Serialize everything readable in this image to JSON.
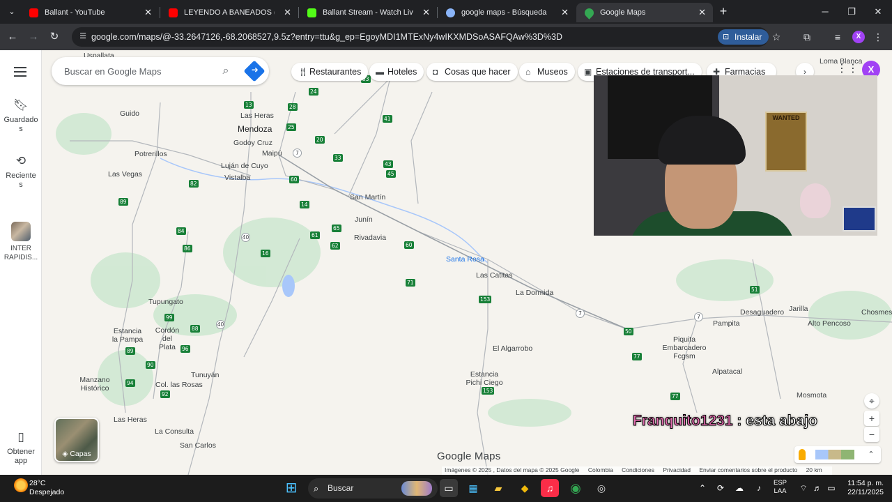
{
  "browser": {
    "tabs": [
      {
        "title": "Ballant - YouTube",
        "favicon_color": "#ff0000",
        "active": false
      },
      {
        "title": "LEYENDO A BANEADOS (de nu",
        "favicon_color": "#ff0000",
        "active": false
      },
      {
        "title": "Ballant Stream - Watch Live on",
        "favicon_color": "#53fc18",
        "active": false
      },
      {
        "title": "google maps - Búsqueda",
        "favicon_color": "#8ab4f8",
        "active": false
      },
      {
        "title": "Google Maps",
        "favicon_color": "#34a853",
        "active": true
      }
    ],
    "url": "google.com/maps/@-33.2647126,-68.2068527,9.5z?entry=ttu&g_ep=EgoyMDI1MTExNy4wIKXMDSoASAFQAw%3D%3D",
    "install_label": "Instalar",
    "profile_letter": "X"
  },
  "rail": {
    "saved": "Guardados",
    "recent": "Recientes",
    "pinned_app": "INTER RAPIDIS...",
    "get_app": "Obtener app"
  },
  "search": {
    "placeholder": "Buscar en Google Maps"
  },
  "chips": [
    {
      "label": "Restaurantes",
      "icon": "fork-knife-icon"
    },
    {
      "label": "Hoteles",
      "icon": "bed-icon"
    },
    {
      "label": "Cosas que hacer",
      "icon": "camera-icon"
    },
    {
      "label": "Museos",
      "icon": "museum-icon"
    },
    {
      "label": "Estaciones de transport...",
      "icon": "train-icon"
    },
    {
      "label": "Farmacias",
      "icon": "pharmacy-icon"
    }
  ],
  "map": {
    "places": [
      {
        "name": "Uspallata",
        "cls": ""
      },
      {
        "name": "Guido",
        "cls": ""
      },
      {
        "name": "Las Heras",
        "cls": ""
      },
      {
        "name": "Mendoza",
        "cls": "city"
      },
      {
        "name": "Godoy Cruz",
        "cls": ""
      },
      {
        "name": "Maipú",
        "cls": ""
      },
      {
        "name": "Potrerillos",
        "cls": ""
      },
      {
        "name": "Luján de Cuyo",
        "cls": ""
      },
      {
        "name": "Las Vegas",
        "cls": ""
      },
      {
        "name": "Vistalba",
        "cls": ""
      },
      {
        "name": "San Martín",
        "cls": ""
      },
      {
        "name": "Junín",
        "cls": ""
      },
      {
        "name": "Rivadavia",
        "cls": ""
      },
      {
        "name": "Santa Rosa",
        "cls": "water"
      },
      {
        "name": "Las Catitas",
        "cls": ""
      },
      {
        "name": "La Dormida",
        "cls": ""
      },
      {
        "name": "Tupungato",
        "cls": ""
      },
      {
        "name": "Estancia la Pampa",
        "cls": ""
      },
      {
        "name": "Cordón del Plata",
        "cls": ""
      },
      {
        "name": "El Algarrobo",
        "cls": ""
      },
      {
        "name": "Tunuyán",
        "cls": ""
      },
      {
        "name": "Manzano Histórico",
        "cls": ""
      },
      {
        "name": "Col. las Rosas",
        "cls": ""
      },
      {
        "name": "Estancia Pichi Ciego",
        "cls": ""
      },
      {
        "name": "Las Heras",
        "cls": ""
      },
      {
        "name": "La Consulta",
        "cls": ""
      },
      {
        "name": "San Carlos",
        "cls": ""
      },
      {
        "name": "Desaguadero",
        "cls": ""
      },
      {
        "name": "Jarilla",
        "cls": ""
      },
      {
        "name": "Chosmes",
        "cls": ""
      },
      {
        "name": "Pampita",
        "cls": ""
      },
      {
        "name": "Alto Pencoso",
        "cls": ""
      },
      {
        "name": "Piquita Embarcadero Fcgsm",
        "cls": ""
      },
      {
        "name": "Alpatacal",
        "cls": ""
      },
      {
        "name": "Mosmota",
        "cls": ""
      },
      {
        "name": "Loma Blanca",
        "cls": ""
      }
    ],
    "route_shields": [
      "24",
      "13",
      "28",
      "25",
      "20",
      "41",
      "33",
      "43",
      "45",
      "82",
      "89",
      "60",
      "14",
      "84",
      "86",
      "61",
      "65",
      "62",
      "16",
      "60",
      "71",
      "153",
      "99",
      "88",
      "89",
      "96",
      "90",
      "94",
      "92",
      "50",
      "77",
      "77",
      "51",
      "153",
      "53"
    ],
    "national_shields": [
      "7",
      "40",
      "40",
      "7",
      "7"
    ],
    "logo": "Google Maps",
    "attribution": [
      "Imágenes © 2025 , Datos del mapa © 2025 Google",
      "Colombia",
      "Condiciones",
      "Privacidad",
      "Enviar comentarios sobre el producto",
      "20 km"
    ],
    "layers_label": "Capas"
  },
  "webcam": {
    "poster_text": "WANTED"
  },
  "chat": {
    "user": "Franquito1231",
    "separator": ":",
    "message": "esta abajo"
  },
  "taskbar": {
    "temperature": "28°C",
    "weather": "Despejado",
    "search_label": "Buscar",
    "lang1": "ESP",
    "lang2": "LAA",
    "time": "11:54 p. m.",
    "date": "22/11/2025"
  }
}
